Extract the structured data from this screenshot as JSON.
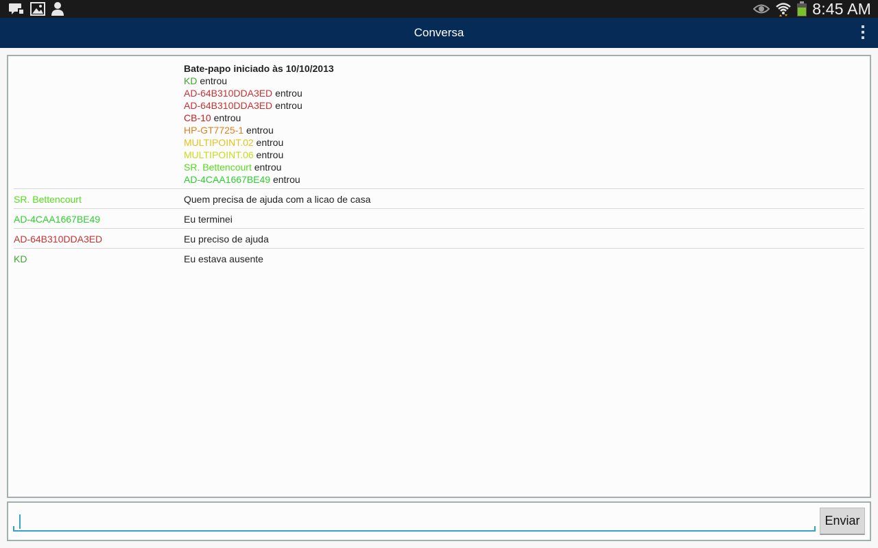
{
  "status_bar": {
    "time": "8:45 AM",
    "left_icons": [
      "message-notification-icon",
      "gallery-icon",
      "contact-icon"
    ],
    "right_icons": [
      "eye-icon",
      "wifi-icon",
      "battery-icon"
    ]
  },
  "action_bar": {
    "title": "Conversa",
    "overflow_icon": "overflow-menu-icon"
  },
  "chat": {
    "started_text": "Bate-papo iniciado às 10/10/2013",
    "joined_suffix": "entrou",
    "joined": [
      {
        "name": "KD",
        "color": "#3caa2c"
      },
      {
        "name": "AD-64B310DDA3ED",
        "color": "#c83232"
      },
      {
        "name": "AD-64B310DDA3ED",
        "color": "#c83232"
      },
      {
        "name": "CB-10",
        "color": "#d01c1c"
      },
      {
        "name": "HP-GT7725-1",
        "color": "#e0801c"
      },
      {
        "name": "MULTIPOINT.02",
        "color": "#e5c21a"
      },
      {
        "name": "MULTIPOINT.06",
        "color": "#c8dc1a"
      },
      {
        "name": "SR. Bettencourt",
        "color": "#55dc1c"
      },
      {
        "name": "AD-4CAA1667BE49",
        "color": "#2cd22c"
      }
    ],
    "messages": [
      {
        "sender": "SR. Bettencourt",
        "sender_color": "#55dc1c",
        "text": "Quem precisa de ajuda com a licao de casa"
      },
      {
        "sender": "AD-4CAA1667BE49",
        "sender_color": "#2cd22c",
        "text": "Eu terminei"
      },
      {
        "sender": "AD-64B310DDA3ED",
        "sender_color": "#c83232",
        "text": "Eu preciso de ajuda"
      },
      {
        "sender": "KD",
        "sender_color": "#3caa2c",
        "text": "Eu estava ausente"
      }
    ]
  },
  "composer": {
    "input_value": "",
    "send_label": "Enviar"
  },
  "colors": {
    "action_bar": "#062b57",
    "status_bar": "#1a1a1a",
    "accent": "#33a3c7"
  }
}
